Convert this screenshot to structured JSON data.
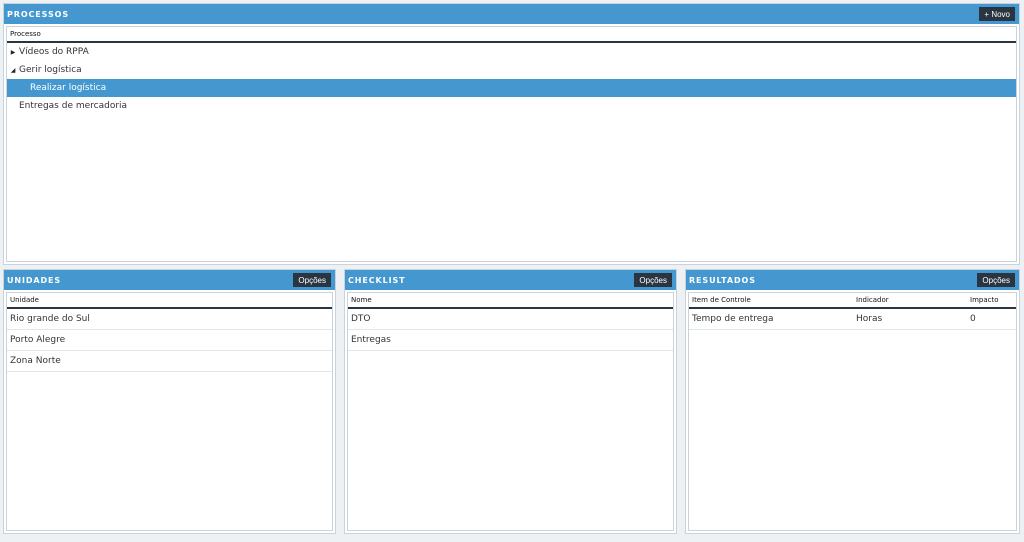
{
  "processos": {
    "title": "PROCESSOS",
    "new_button": "+ Novo",
    "column": "Processo",
    "items": [
      {
        "label": "Vídeos do RPPA",
        "caret": "▶"
      },
      {
        "label": "Gerir logística",
        "caret": "◢"
      },
      {
        "label": "Realizar logística",
        "caret": ""
      },
      {
        "label": "Entregas de mercadoria",
        "caret": ""
      }
    ]
  },
  "unidades": {
    "title": "UNIDADES",
    "options_button": "Opções",
    "column": "Unidade",
    "rows": [
      "Rio grande do Sul",
      "Porto Alegre",
      "Zona Norte"
    ]
  },
  "checklist": {
    "title": "CHECKLIST",
    "options_button": "Opções",
    "column": "Nome",
    "rows": [
      "DTO",
      "Entregas"
    ]
  },
  "resultados": {
    "title": "RESULTADOS",
    "options_button": "Opções",
    "columns": [
      "Item de Controle",
      "Indicador",
      "Impacto"
    ],
    "rows": [
      {
        "item": "Tempo de entrega",
        "indicador": "Horas",
        "impacto": "0"
      }
    ]
  },
  "colors": {
    "header": "#4597d0",
    "selected": "#4597d0",
    "button": "#2a3542"
  }
}
